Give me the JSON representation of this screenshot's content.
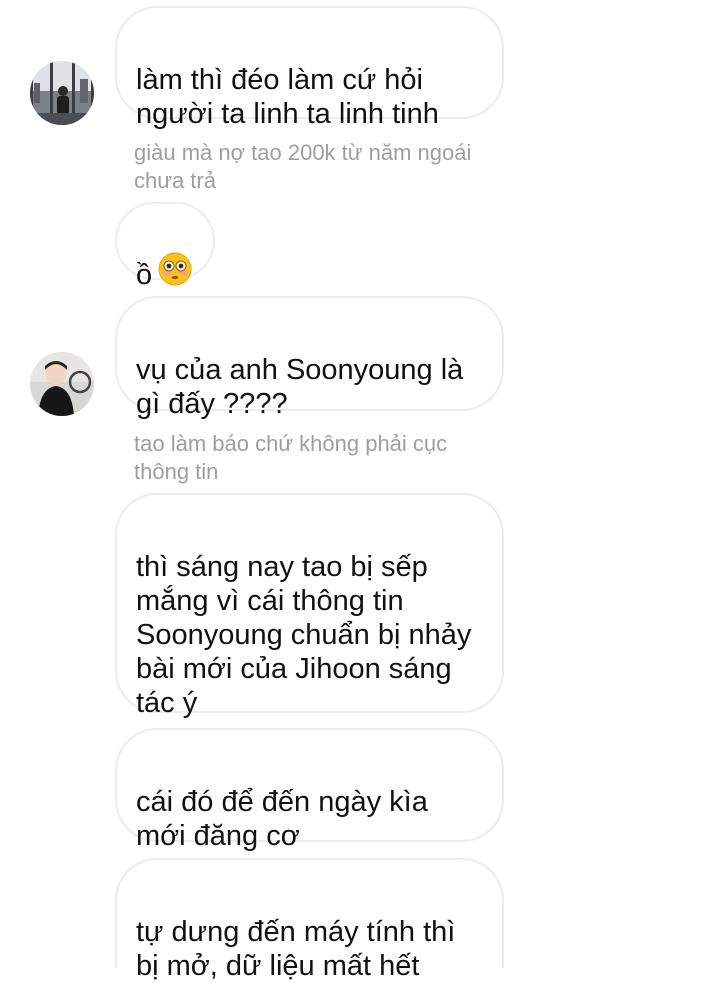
{
  "conversation": {
    "messages": [
      {
        "text": "làm thì đéo làm cứ hỏi\nngười ta linh ta linh tinh"
      },
      {
        "reply_context": "giàu mà nợ tao 200k từ năm ngoái\nchưa trả",
        "text": "ồ",
        "emoji": "flushed-face-emoji"
      },
      {
        "text": "vụ của anh Soonyoung là\ngì đấy ????"
      },
      {
        "reply_context": "tao làm báo chứ không phải cục\nthông tin",
        "text": "thì sáng nay tao bị sếp\nmắng vì cái thông tin\nSoonyoung chuẩn bị nhảy\nbài mới của Jihoon sáng\ntác ý"
      },
      {
        "text": "cái đó để đến ngày kìa\nmới đăng cơ"
      },
      {
        "text": "tự dưng đến máy tính thì\nbị mở, dữ liệu mất hết"
      }
    ]
  },
  "colors": {
    "bubble_border": "#ececec",
    "reply_text": "#9e9e9e",
    "message_text": "#111111"
  }
}
